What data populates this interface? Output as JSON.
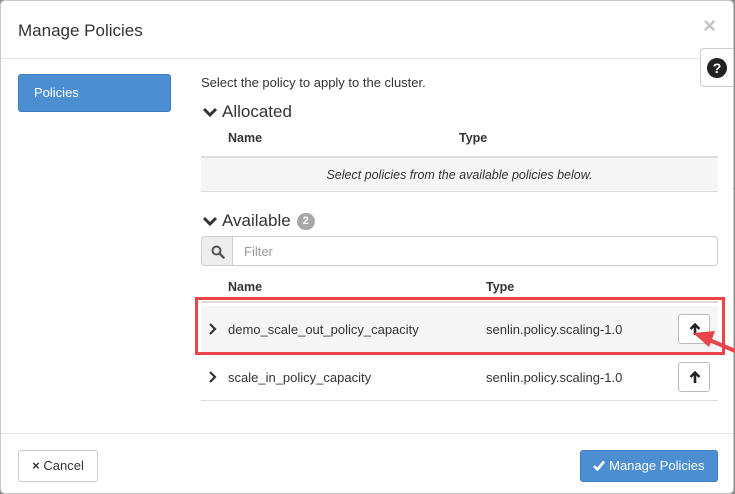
{
  "modal": {
    "title": "Manage Policies",
    "close_glyph": "×",
    "help_glyph": "?"
  },
  "nav": {
    "items": [
      {
        "label": "Policies",
        "active": true
      }
    ]
  },
  "intro_text": "Select the policy to apply to the cluster.",
  "allocated": {
    "heading": "Allocated",
    "columns": [
      "Name",
      "Type"
    ],
    "empty_message": "Select policies from the available policies below."
  },
  "available": {
    "heading": "Available",
    "count": "2",
    "filter_placeholder": "Filter",
    "columns": [
      "Name",
      "Type"
    ],
    "rows": [
      {
        "name": "demo_scale_out_policy_capacity",
        "type": "senlin.policy.scaling-1.0",
        "highlighted": true
      },
      {
        "name": "scale_in_policy_capacity",
        "type": "senlin.policy.scaling-1.0",
        "highlighted": false
      }
    ]
  },
  "footer": {
    "cancel_label": "Cancel",
    "cancel_icon": "×",
    "submit_label": "Manage Policies",
    "submit_icon": "check-icon"
  },
  "colors": {
    "primary": "#4c8ed2",
    "annotation_red": "#e8444a"
  }
}
